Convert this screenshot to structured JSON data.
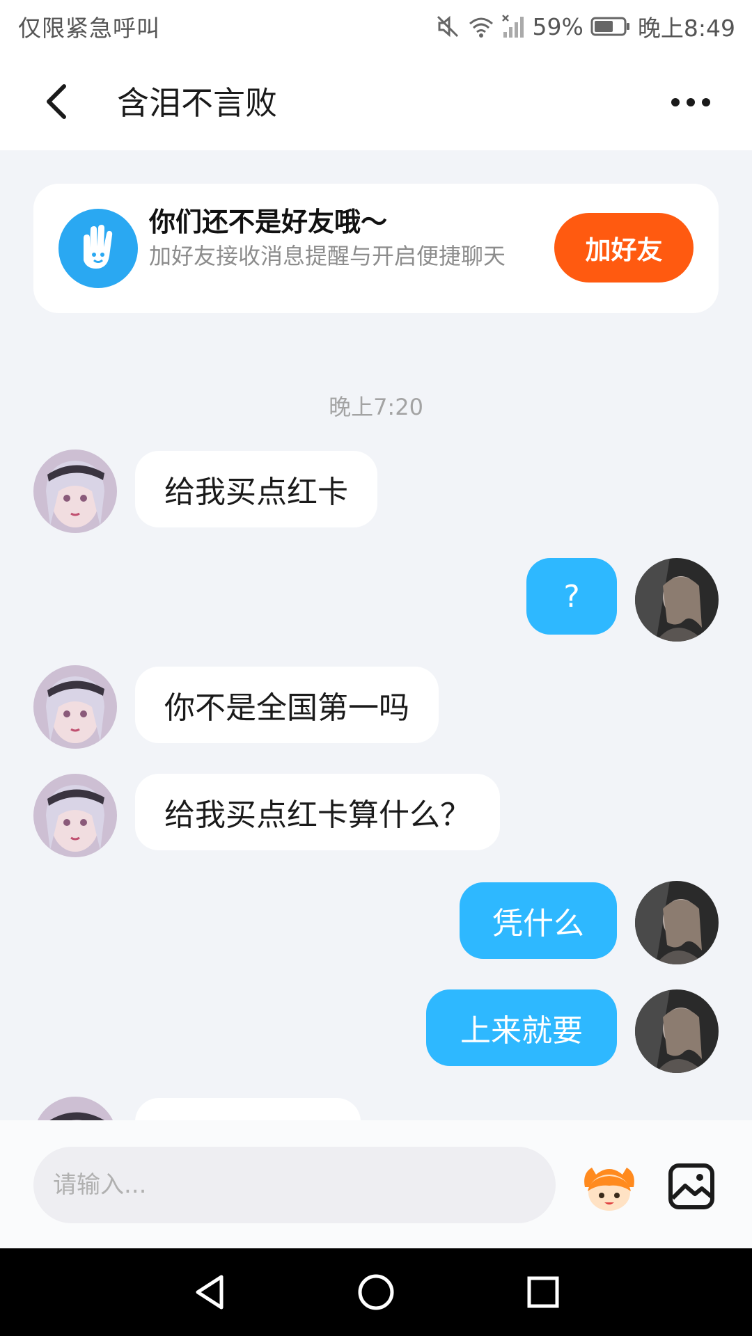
{
  "status_bar": {
    "left_text": "仅限紧急呼叫",
    "battery_percent": "59%",
    "time": "晚上8:49"
  },
  "header": {
    "title": "含泪不言败"
  },
  "friend_banner": {
    "title": "你们还不是好友哦～",
    "subtitle": "加好友接收消息提醒与开启便捷聊天",
    "button_label": "加好友"
  },
  "chat": {
    "timestamp": "晚上7:20",
    "messages": [
      {
        "direction": "in",
        "text": "给我买点红卡"
      },
      {
        "direction": "out",
        "text": "?"
      },
      {
        "direction": "in",
        "text": "你不是全国第一吗"
      },
      {
        "direction": "in",
        "text": "给我买点红卡算什么？"
      },
      {
        "direction": "out",
        "text": "凭什么"
      },
      {
        "direction": "out",
        "text": "上来就要"
      }
    ]
  },
  "input": {
    "placeholder": "请输入..."
  },
  "colors": {
    "accent_orange": "#ff5a10",
    "outgoing_bubble": "#2eb8ff",
    "banner_icon": "#2aa8f2"
  },
  "icons": [
    "back-icon",
    "more-icon",
    "wave-hand-icon",
    "emoji-icon",
    "image-icon",
    "nav-back-icon",
    "nav-home-icon",
    "nav-recents-icon"
  ]
}
